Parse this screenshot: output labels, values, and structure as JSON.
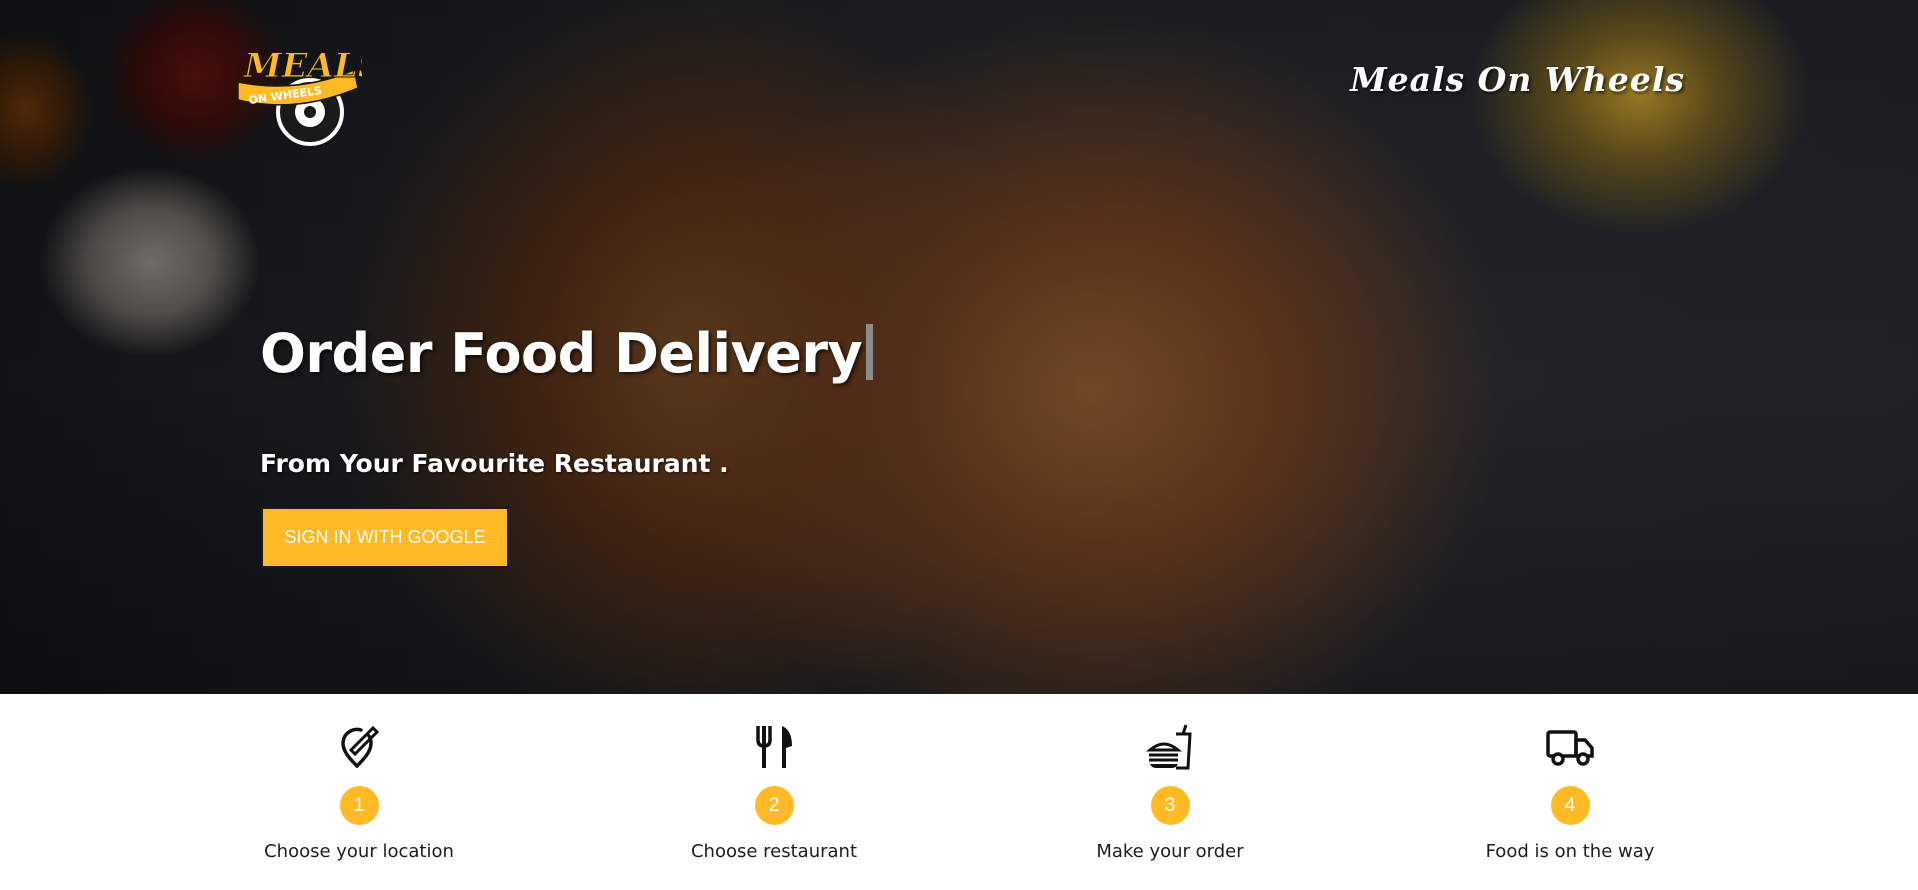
{
  "brand": {
    "name": "Meals On Wheels",
    "logo_text_top": "MEALS",
    "logo_text_bottom": "ON WHEELS"
  },
  "hero": {
    "headline": "Order Food Delivery",
    "subheadline": "From Your Favourite Restaurant .",
    "signin_label": "SIGN IN WITH GOOGLE"
  },
  "steps": [
    {
      "number": "1",
      "label": "Choose your location",
      "icon": "location-pin-icon"
    },
    {
      "number": "2",
      "label": "Choose restaurant",
      "icon": "fork-knife-icon"
    },
    {
      "number": "3",
      "label": "Make your order",
      "icon": "burger-drink-icon"
    },
    {
      "number": "4",
      "label": "Food is on the way",
      "icon": "delivery-truck-icon"
    }
  ],
  "colors": {
    "accent": "#ffba26",
    "text_dark": "#1d1d1d",
    "hero_text": "#ffffff"
  }
}
